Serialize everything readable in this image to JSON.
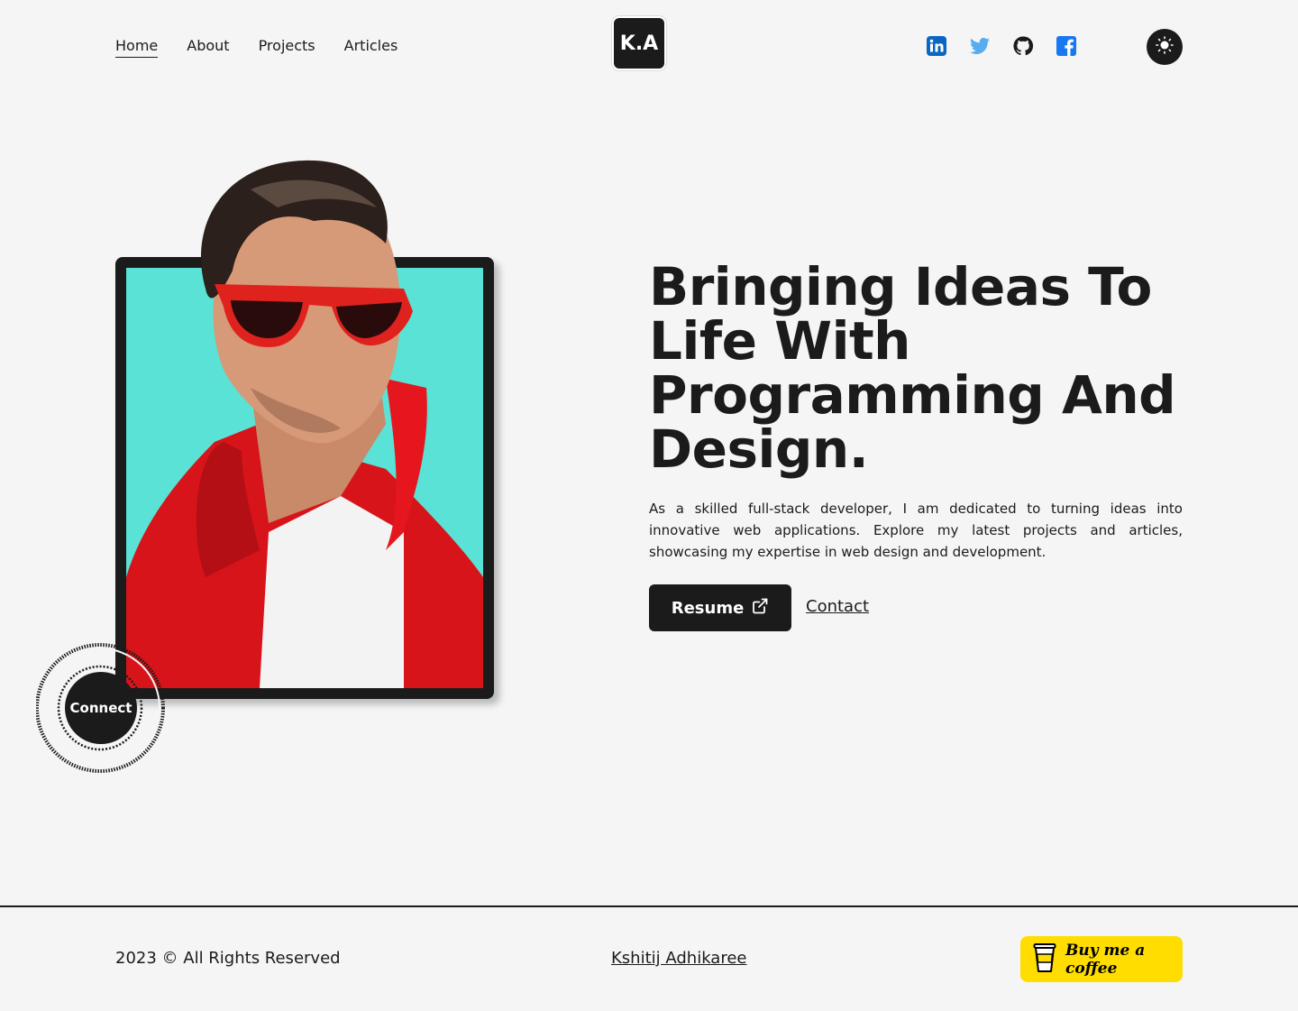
{
  "nav": {
    "items": [
      {
        "label": "Home",
        "active": true
      },
      {
        "label": "About",
        "active": false
      },
      {
        "label": "Projects",
        "active": false
      },
      {
        "label": "Articles",
        "active": false
      }
    ]
  },
  "logo": {
    "text": "K.A"
  },
  "socials": {
    "icons": [
      "linkedin-icon",
      "twitter-icon",
      "github-icon",
      "facebook-icon"
    ],
    "colors": {
      "linkedin": "#0a66c2",
      "twitter": "#55acee",
      "github": "#1b1b1b",
      "facebook": "#1877f2"
    }
  },
  "theme_toggle": {
    "icon": "sun-icon"
  },
  "hero": {
    "headline": "Bringing Ideas To Life With Programming And Design.",
    "intro": "As a skilled full-stack developer, I am dedicated to turning ideas into innovative web applications. Explore my latest projects and articles, showcasing my expertise in web design and development.",
    "resume_label": "Resume",
    "contact_label": "Contact",
    "connect_label": "Connect"
  },
  "footer": {
    "copyright": "2023 © All Rights Reserved",
    "author": "Kshitij Adhikaree",
    "coffee_label": "Buy me a coffee"
  },
  "colors": {
    "background": "#f5f5f5",
    "dark": "#1b1b1b",
    "accent_teal": "#5ae2d6",
    "coffee_yellow": "#ffdd00"
  }
}
